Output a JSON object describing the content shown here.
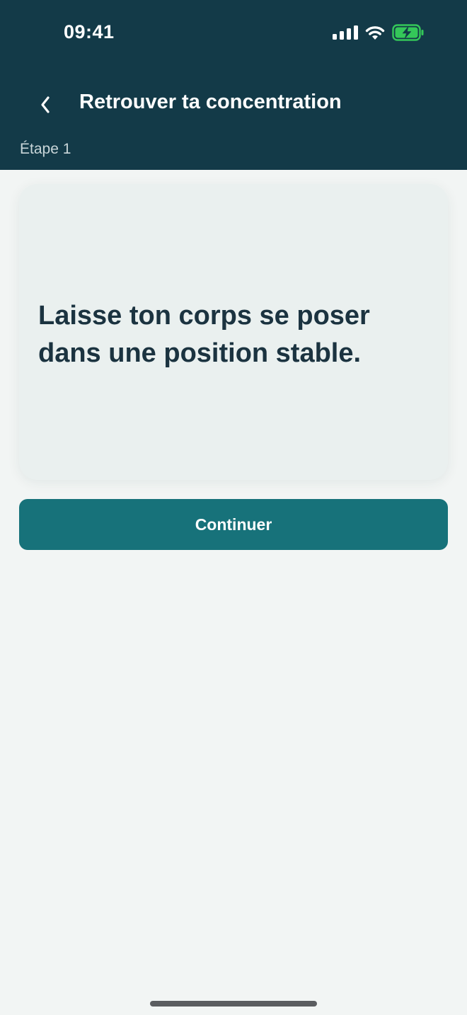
{
  "status_bar": {
    "time": "09:41",
    "icons": [
      "signal-icon",
      "wifi-icon",
      "battery-charging-icon"
    ]
  },
  "header": {
    "back_icon": "chevron-left-icon",
    "title": "Retrouver ta concentration",
    "step": "Étape 1"
  },
  "card": {
    "text": "Laisse ton corps se poser dans une position stable."
  },
  "actions": {
    "continue_label": "Continuer"
  },
  "colors": {
    "header_bg": "#133a48",
    "page_bg": "#f2f5f4",
    "card_bg": "#eaf0ef",
    "accent": "#17727a",
    "battery_green": "#34c759"
  }
}
